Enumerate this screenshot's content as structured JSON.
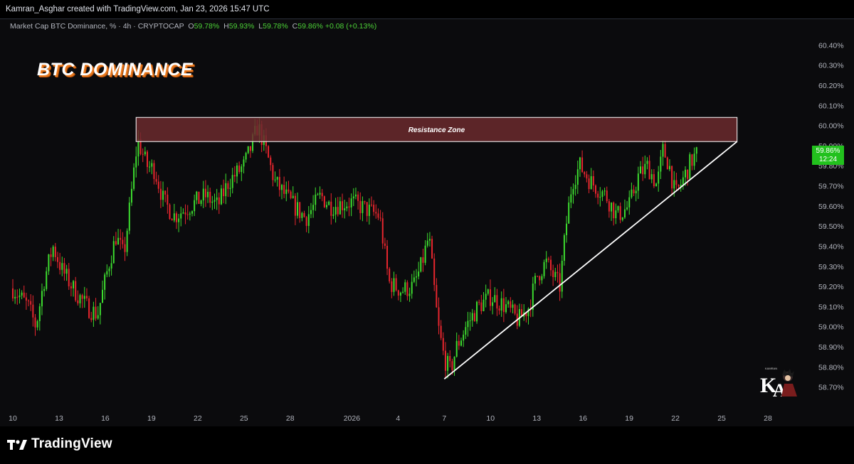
{
  "header": {
    "credit": "Kamran_Asghar created with TradingView.com, Jan 23, 2026 15:47 UTC"
  },
  "legend": {
    "symbol": "Market Cap BTC Dominance, % · 4h · CRYPTOCAP",
    "open_label": "O",
    "open": "59.78%",
    "high_label": "H",
    "high": "59.93%",
    "low_label": "L",
    "low": "59.78%",
    "close_label": "C",
    "close": "59.86%",
    "change": "+0.08 (+0.13%)"
  },
  "overlay_title": "BTC DOMINANCE",
  "price_tag": {
    "price": "59.86%",
    "countdown": "12:24"
  },
  "footer": {
    "brand": "TradingView"
  },
  "colors": {
    "up": "#3ddc2f",
    "down": "#e8262e",
    "zone_fill": "#6b2a2e",
    "zone_border": "#ffffff",
    "trendline": "#ffffff",
    "price_tag": "#22c11d"
  },
  "chart_data": {
    "type": "candlestick",
    "title": "BTC DOMINANCE",
    "ylabel": "",
    "ylim": [
      58.66,
      60.44
    ],
    "y_ticks": [
      "60.40%",
      "60.30%",
      "60.20%",
      "60.10%",
      "60.00%",
      "59.90%",
      "59.80%",
      "59.70%",
      "59.60%",
      "59.50%",
      "59.40%",
      "59.30%",
      "59.20%",
      "59.10%",
      "59.00%",
      "58.90%",
      "58.80%",
      "58.70%"
    ],
    "x_ticks": [
      "10",
      "13",
      "16",
      "19",
      "22",
      "25",
      "28",
      "2026",
      "4",
      "7",
      "10",
      "13",
      "16",
      "19",
      "22",
      "25",
      "28"
    ],
    "x_tick_dates": [
      "Dec 10",
      "Dec 13",
      "Dec 16",
      "Dec 19",
      "Dec 22",
      "Dec 25",
      "Dec 28",
      "Jan 1",
      "Jan 4",
      "Jan 7",
      "Jan 10",
      "Jan 13",
      "Jan 16",
      "Jan 19",
      "Jan 22",
      "Jan 25",
      "Jan 28"
    ],
    "path": [
      [
        "Dec 10",
        59.19
      ],
      [
        "Dec 11",
        59.1
      ],
      [
        "Dec 11.5",
        59.0
      ],
      [
        "Dec 12",
        59.22
      ],
      [
        "Dec 12.6",
        59.4
      ],
      [
        "Dec 13.2",
        59.28
      ],
      [
        "Dec 14",
        59.18
      ],
      [
        "Dec 14.8",
        59.1
      ],
      [
        "Dec 15.5",
        59.06
      ],
      [
        "Dec 16.2",
        59.3
      ],
      [
        "Dec 16.7",
        59.45
      ],
      [
        "Dec 17.2",
        59.35
      ],
      [
        "Dec 17.6",
        59.6
      ],
      [
        "Dec 18.1",
        59.93
      ],
      [
        "Dec 18.7",
        59.8
      ],
      [
        "Dec 19.2",
        59.78
      ],
      [
        "Dec 19.8",
        59.62
      ],
      [
        "Dec 20.5",
        59.55
      ],
      [
        "Dec 21.5",
        59.6
      ],
      [
        "Dec 22.5",
        59.65
      ],
      [
        "Dec 23.3",
        59.6
      ],
      [
        "Dec 24",
        59.72
      ],
      [
        "Dec 25",
        59.8
      ],
      [
        "Dec 25.5",
        59.9
      ],
      [
        "Dec 25.9",
        60.0
      ],
      [
        "Dec 26.4",
        59.88
      ],
      [
        "Dec 27",
        59.72
      ],
      [
        "Dec 28",
        59.62
      ],
      [
        "Dec 29",
        59.54
      ],
      [
        "Dec 30",
        59.65
      ],
      [
        "Dec 30.6",
        59.6
      ],
      [
        "Jan 1",
        59.62
      ],
      [
        "Jan 2",
        59.58
      ],
      [
        "Jan 2.8",
        59.55
      ],
      [
        "Jan 3.4",
        59.22
      ],
      [
        "Jan 4.2",
        59.18
      ],
      [
        "Jan 5",
        59.2
      ],
      [
        "Jan 5.5",
        59.3
      ],
      [
        "Jan 6",
        59.45
      ],
      [
        "Jan 6.3",
        59.22
      ],
      [
        "Jan 6.6",
        59.0
      ],
      [
        "Jan 7",
        58.84
      ],
      [
        "Jan 7.4",
        58.78
      ],
      [
        "Jan 7.8",
        58.9
      ],
      [
        "Jan 8.4",
        59.0
      ],
      [
        "Jan 9.2",
        59.1
      ],
      [
        "Jan 10",
        59.15
      ],
      [
        "Jan 11",
        59.1
      ],
      [
        "Jan 11.8",
        59.03
      ],
      [
        "Jan 12.5",
        59.1
      ],
      [
        "Jan 13",
        59.25
      ],
      [
        "Jan 13.6",
        59.32
      ],
      [
        "Jan 14.1",
        59.25
      ],
      [
        "Jan 14.5",
        59.2
      ],
      [
        "Jan 14.9",
        59.5
      ],
      [
        "Jan 15.3",
        59.72
      ],
      [
        "Jan 15.8",
        59.8
      ],
      [
        "Jan 16.5",
        59.72
      ],
      [
        "Jan 17.5",
        59.65
      ],
      [
        "Jan 18.2",
        59.55
      ],
      [
        "Jan 19",
        59.6
      ],
      [
        "Jan 19.6",
        59.75
      ],
      [
        "Jan 20.2",
        59.8
      ],
      [
        "Jan 20.8",
        59.7
      ],
      [
        "Jan 21.2",
        59.88
      ],
      [
        "Jan 21.6",
        59.8
      ],
      [
        "Jan 22",
        59.65
      ],
      [
        "Jan 22.6",
        59.75
      ],
      [
        "Jan 23",
        59.82
      ],
      [
        "Jan 23.4",
        59.86
      ]
    ],
    "annotations": [
      {
        "type": "rectangle",
        "label": "Resistance Zone",
        "x": [
          "Dec 18",
          "Jan 26"
        ],
        "y": [
          59.92,
          60.04
        ]
      },
      {
        "type": "trendline",
        "x": [
          "Jan 7",
          "Jan 26"
        ],
        "y": [
          58.74,
          59.92
        ]
      }
    ],
    "last_price": 59.86,
    "grid": false,
    "legend": "top-left"
  }
}
